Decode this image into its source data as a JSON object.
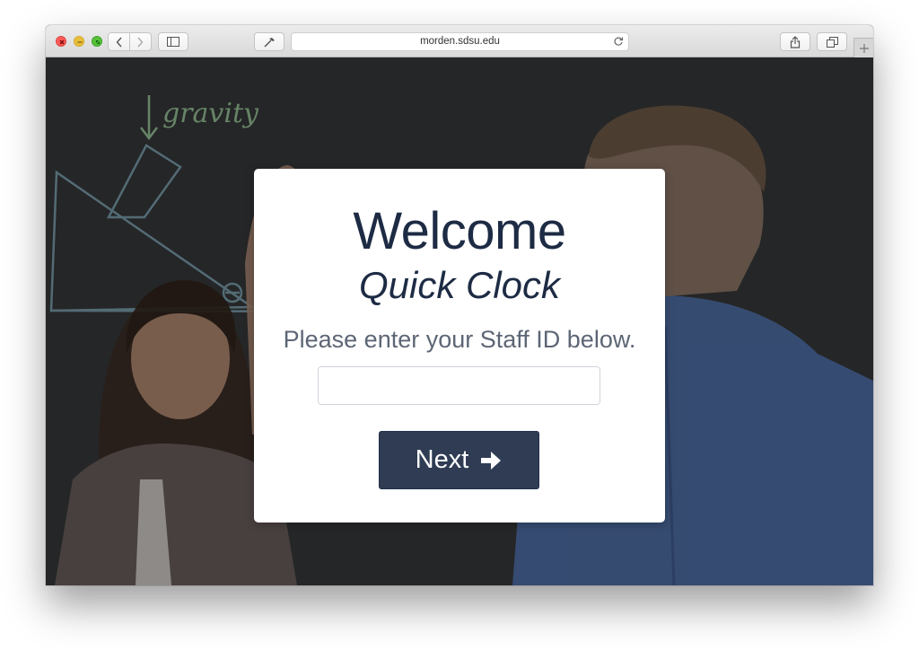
{
  "browser": {
    "url": "morden.sdsu.edu"
  },
  "card": {
    "title": "Welcome",
    "subtitle": "Quick Clock",
    "instructions": "Please enter your Staff ID below.",
    "staff_id": {
      "value": "",
      "placeholder": ""
    },
    "next_button": {
      "label": "Next",
      "icon": "arrow-right-icon"
    }
  },
  "background": {
    "chalkboard_text": "gravity"
  },
  "colors": {
    "card_bg": "#ffffff",
    "title": "#1d2b44",
    "instruction_text": "#5d6675",
    "button_bg": "#2f3c54",
    "button_text": "#ffffff",
    "chalk": "#8fb6c7",
    "chalk_green": "#9fcf9f"
  }
}
